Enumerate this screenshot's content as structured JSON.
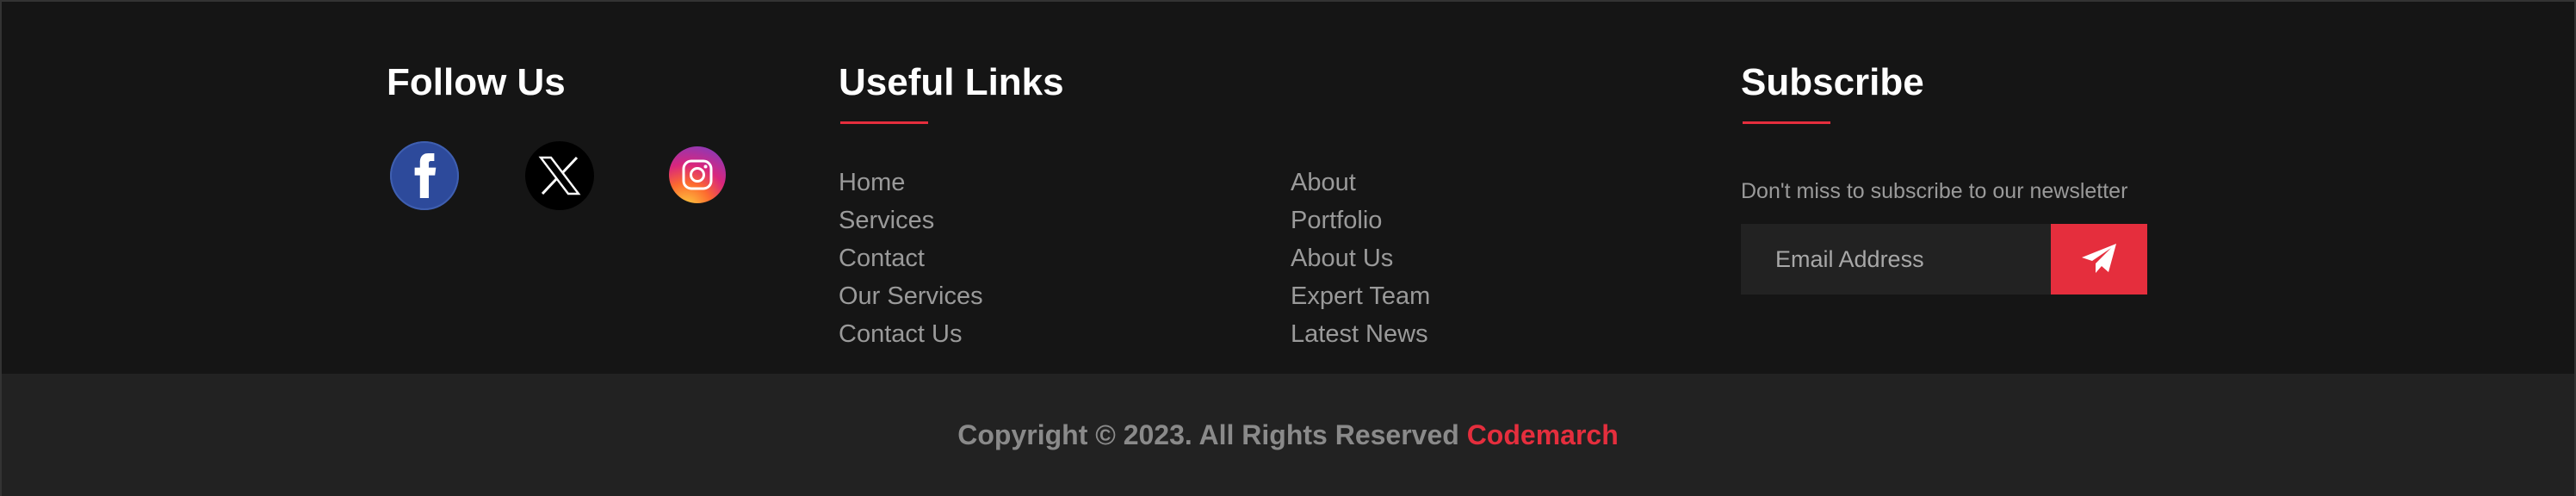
{
  "colors": {
    "accent": "#e52e3d",
    "background": "#151515",
    "bottom_bar": "#222222",
    "link_text": "#9a9a9a",
    "facebook": "#2d4a9b"
  },
  "follow": {
    "heading": "Follow Us",
    "socials": [
      {
        "name": "facebook",
        "icon": "facebook-icon"
      },
      {
        "name": "x",
        "icon": "x-twitter-icon"
      },
      {
        "name": "instagram",
        "icon": "instagram-icon"
      }
    ]
  },
  "useful_links": {
    "heading": "Useful Links",
    "column_a": [
      "Home",
      "Services",
      "Contact",
      "Our Services",
      "Contact Us"
    ],
    "column_b": [
      "About",
      "Portfolio",
      "About Us",
      "Expert Team",
      "Latest News"
    ]
  },
  "subscribe": {
    "heading": "Subscribe",
    "tagline": "Don't miss to subscribe to our newsletter",
    "email_placeholder": "Email Address",
    "submit_icon": "paper-plane-icon"
  },
  "footer": {
    "copyright": "Copyright © 2023. All Rights Reserved ",
    "brand": "Codemarch"
  }
}
